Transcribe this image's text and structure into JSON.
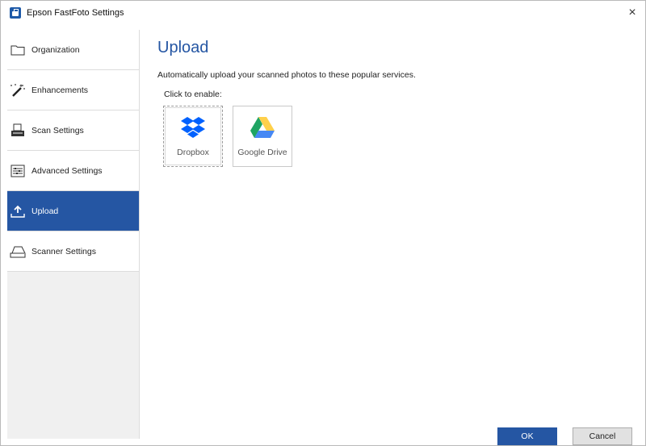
{
  "window": {
    "title": "Epson FastFoto Settings",
    "close_glyph": "×"
  },
  "sidebar": {
    "items": [
      {
        "label": "Organization",
        "icon": "folder-icon",
        "active": false
      },
      {
        "label": "Enhancements",
        "icon": "magic-wand-icon",
        "active": false
      },
      {
        "label": "Scan Settings",
        "icon": "scanner-icon",
        "active": false
      },
      {
        "label": "Advanced Settings",
        "icon": "sliders-icon",
        "active": false
      },
      {
        "label": "Upload",
        "icon": "upload-icon",
        "active": true
      },
      {
        "label": "Scanner Settings",
        "icon": "scanner-tray-icon",
        "active": false
      }
    ]
  },
  "main": {
    "title": "Upload",
    "description": "Automatically upload your scanned photos to these popular services.",
    "click_label": "Click to enable:",
    "services": [
      {
        "label": "Dropbox",
        "icon": "dropbox-icon"
      },
      {
        "label": "Google Drive",
        "icon": "google-drive-icon"
      }
    ]
  },
  "footer": {
    "ok_label": "OK",
    "cancel_label": "Cancel"
  },
  "colors": {
    "accent": "#2556a3",
    "dropbox": "#0061fe",
    "gdrive_green": "#1fa463",
    "gdrive_yellow": "#ffd04b",
    "gdrive_blue": "#4688f4"
  }
}
